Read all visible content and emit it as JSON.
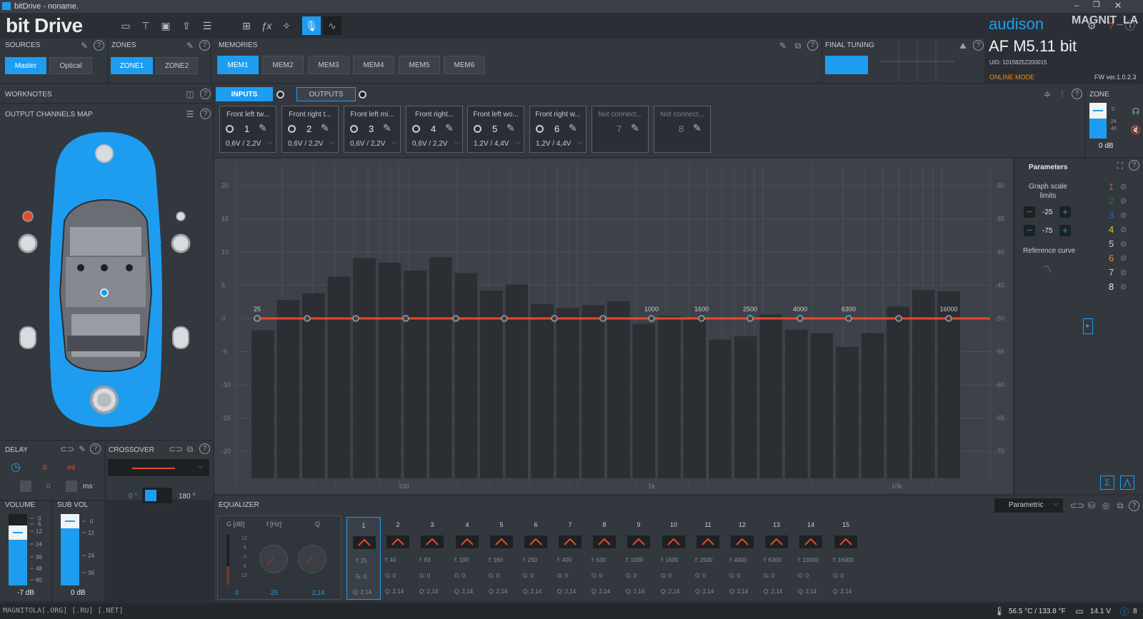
{
  "window": {
    "title": "bitDrive - noname."
  },
  "app": {
    "logo": "bit Drive",
    "brand": "audison",
    "watermark": "MAGNIT_LA"
  },
  "device": {
    "model": "AF M5.11 bit",
    "uid": "UID: 10158252200015",
    "mode": "ONLINE MODE",
    "fw": "FW ver.1.0.2.3"
  },
  "sections": {
    "sources": "SOURCES",
    "zones": "ZONES",
    "memories": "MEMORIES",
    "final_tuning": "FINAL TUNING",
    "worknotes": "WORKNOTES",
    "output_map": "OUTPUT CHANNELS MAP",
    "delay": "DELAY",
    "crossover": "CROSSOVER",
    "volume": "VOLUME",
    "subvol": "SUB VOL",
    "equalizer": "EQUALIZER",
    "zone": "ZONE",
    "parameters": "Parameters"
  },
  "sources": [
    "Master",
    "Optical"
  ],
  "zones": [
    "ZONE1",
    "ZONE2"
  ],
  "memories": [
    "MEM1",
    "MEM2",
    "MEM3",
    "MEM4",
    "MEM5",
    "MEM6"
  ],
  "io_tabs": {
    "inputs": "INPUTS",
    "outputs": "OUTPUTS"
  },
  "channels": [
    {
      "name": "Front left tw...",
      "num": "1",
      "range": "0,6V / 2,2V"
    },
    {
      "name": "Front right t...",
      "num": "2",
      "range": "0,6V / 2,2V"
    },
    {
      "name": "Front left mi...",
      "num": "3",
      "range": "0,6V / 2,2V"
    },
    {
      "name": "Front right...",
      "num": "4",
      "range": "0,6V / 2,2V"
    },
    {
      "name": "Front left wo...",
      "num": "5",
      "range": "1,2V / 4,4V"
    },
    {
      "name": "Front right w...",
      "num": "6",
      "range": "1,2V / 4,4V"
    },
    {
      "name": "Not connect...",
      "num": "7",
      "range": ""
    },
    {
      "name": "Not connect...",
      "num": "8",
      "range": ""
    }
  ],
  "zone_panel": {
    "db": "0 dB",
    "scale": [
      "0",
      "24",
      "40"
    ]
  },
  "graph": {
    "left_ticks": [
      "20",
      "15",
      "10",
      "5",
      "0",
      "-5",
      "-10",
      "-15",
      "-20"
    ],
    "right_ticks": [
      "-30",
      "-35",
      "-40",
      "-45",
      "-50",
      "-55",
      "-60",
      "-65",
      "-70"
    ],
    "x_ticks": [
      "100",
      "1k",
      "10k"
    ],
    "bars_db": [
      -1.8,
      2.8,
      3.8,
      6.3,
      9.1,
      8.4,
      7.2,
      9.2,
      6.8,
      4.2,
      5.1,
      2.2,
      1.6,
      2.0,
      2.6,
      -0.8,
      0.4,
      -0.1,
      -3.2,
      -2.7,
      0.6,
      -1.7,
      -2.2,
      -4.3,
      -2.2,
      1.8,
      4.3,
      4.1
    ],
    "eq_freq_labels": [
      "25",
      "100",
      "1000",
      "1600",
      "2500",
      "4000",
      "6300",
      "16000"
    ]
  },
  "parameters": {
    "scale_label": "Graph scale limits",
    "upper": "-25",
    "lower": "-75",
    "ref_curve": "Reference curve"
  },
  "legend": [
    "1",
    "2",
    "3",
    "4",
    "5",
    "6",
    "7",
    "8"
  ],
  "delay": {
    "value": "0",
    "unit1": "mt",
    "value2": "0",
    "unit2": "ms"
  },
  "crossover": {
    "phase0": "0 °",
    "phase180": "180 °"
  },
  "volume": {
    "ticks": [
      "0",
      "6",
      "12",
      "24",
      "36",
      "48",
      "60"
    ],
    "value": "-7 dB"
  },
  "subvol": {
    "ticks": [
      "0",
      "12",
      "24",
      "36"
    ],
    "value": "0 dB"
  },
  "equalizer": {
    "mode": "Parametric",
    "knob_labels": {
      "g": "G [dB]",
      "f": "f [Hz]",
      "q": "Q"
    },
    "knob_values": {
      "g": "0",
      "f": "25",
      "q": "2,14"
    },
    "g_scale": [
      "12",
      "6",
      "0",
      "6",
      "12"
    ],
    "bands": [
      {
        "n": "1",
        "f": "f: 25",
        "g": "G: 0",
        "q": "Q: 2,14"
      },
      {
        "n": "2",
        "f": "f: 40",
        "g": "G: 0",
        "q": "Q: 2,14"
      },
      {
        "n": "3",
        "f": "f: 63",
        "g": "G: 0",
        "q": "Q: 2,14"
      },
      {
        "n": "4",
        "f": "f: 100",
        "g": "G: 0",
        "q": "Q: 2,14"
      },
      {
        "n": "5",
        "f": "f: 160",
        "g": "G: 0",
        "q": "Q: 2,14"
      },
      {
        "n": "6",
        "f": "f: 250",
        "g": "G: 0",
        "q": "Q: 2,14"
      },
      {
        "n": "7",
        "f": "f: 400",
        "g": "G: 0",
        "q": "Q: 2,14"
      },
      {
        "n": "8",
        "f": "f: 630",
        "g": "G: 0",
        "q": "Q: 2,14"
      },
      {
        "n": "9",
        "f": "f: 1000",
        "g": "G: 0",
        "q": "Q: 2,14"
      },
      {
        "n": "10",
        "f": "f: 1600",
        "g": "G: 0",
        "q": "Q: 2,14"
      },
      {
        "n": "11",
        "f": "f: 2500",
        "g": "G: 0",
        "q": "Q: 2,14"
      },
      {
        "n": "12",
        "f": "f: 4000",
        "g": "G: 0",
        "q": "Q: 2,14"
      },
      {
        "n": "13",
        "f": "f: 6300",
        "g": "G: 0",
        "q": "Q: 2,14"
      },
      {
        "n": "14",
        "f": "f: 10000",
        "g": "G: 0",
        "q": "Q: 2,14"
      },
      {
        "n": "15",
        "f": "f: 16000",
        "g": "G: 0",
        "q": "Q: 2,14"
      }
    ]
  },
  "status": {
    "left": "MAGNITOLA[.ORG] [.RU] [.NET]",
    "temp": "56.5 °C / 133.8 °F",
    "volt": "14.1 V",
    "info": "8"
  },
  "colors": {
    "accent": "#1e9df0",
    "red": "#e54b2c",
    "orange": "#f28a1e",
    "bar": "#2b2e32"
  }
}
